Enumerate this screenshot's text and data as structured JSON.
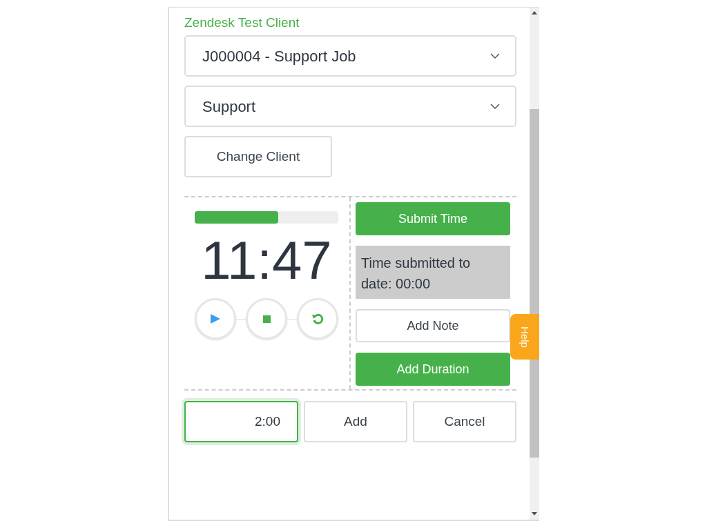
{
  "client": "Zendesk Test Client",
  "job_select": {
    "value": "J000004 - Support Job"
  },
  "task_select": {
    "value": "Support"
  },
  "change_client_button": "Change Client",
  "timer": {
    "level": 0.58,
    "time": "11:47",
    "controls": [
      {
        "kind": "play"
      },
      {
        "kind": "stop"
      },
      {
        "kind": "reset"
      }
    ]
  },
  "submit_button": "Submit Time",
  "submitted_text": "Time submitted to date: 00:00",
  "add_note_button": "Add Note",
  "add_duration_button": "Add Duration",
  "duration": {
    "value": "2:00",
    "focused": true
  },
  "add_button": "Add",
  "cancel_button": "Cancel",
  "help_tab": "Help"
}
